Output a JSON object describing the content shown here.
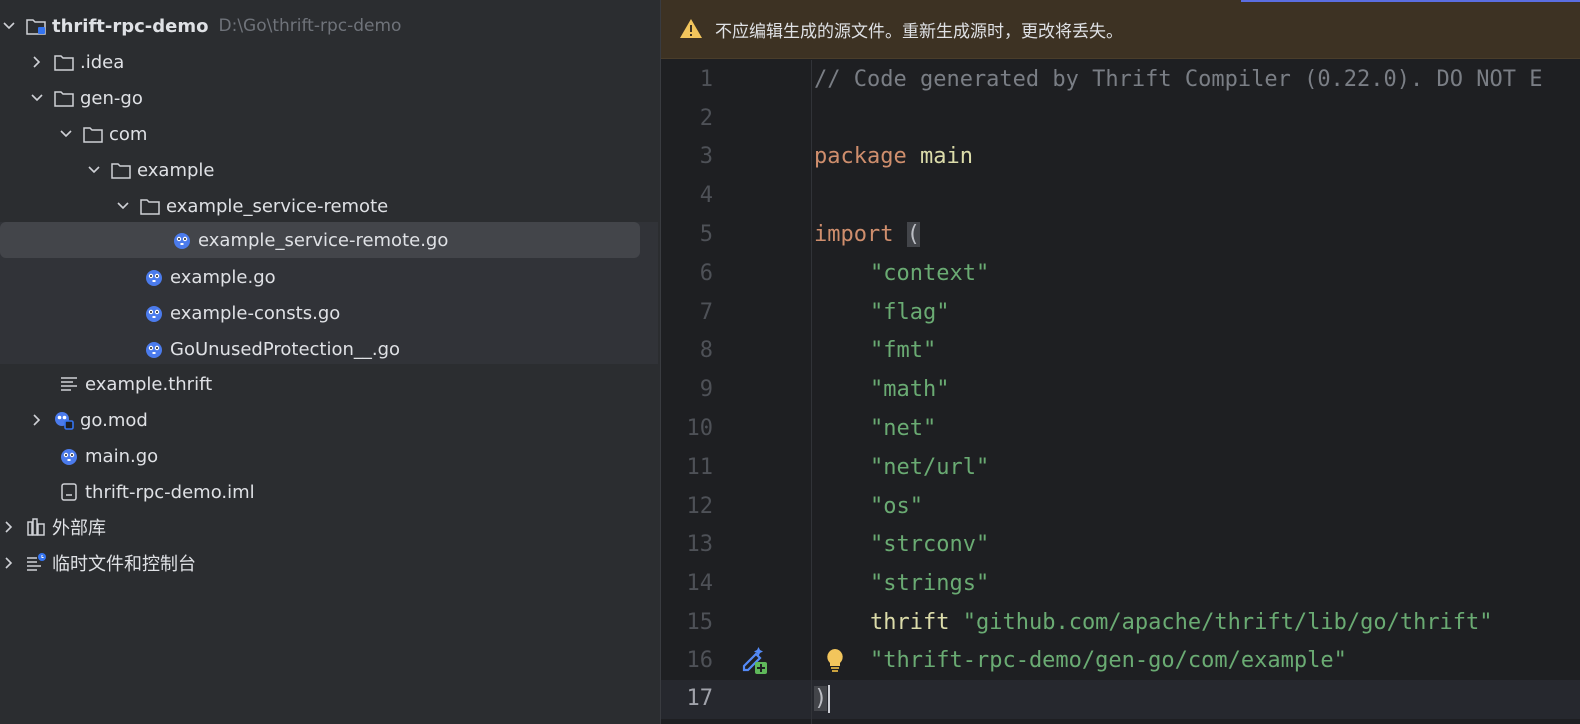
{
  "project_tree": {
    "root": {
      "label": "thrift-rpc-demo",
      "path": "D:\\Go\\thrift-rpc-demo"
    },
    "items": [
      {
        "label": ".idea"
      },
      {
        "label": "gen-go"
      },
      {
        "label": "com"
      },
      {
        "label": "example"
      },
      {
        "label": "example_service-remote"
      },
      {
        "label": "example_service-remote.go"
      },
      {
        "label": "example.go"
      },
      {
        "label": "example-consts.go"
      },
      {
        "label": "GoUnusedProtection__.go"
      },
      {
        "label": "example.thrift"
      },
      {
        "label": "go.mod"
      },
      {
        "label": "main.go"
      },
      {
        "label": "thrift-rpc-demo.iml"
      },
      {
        "label": "外部库"
      },
      {
        "label": "临时文件和控制台"
      }
    ]
  },
  "editor": {
    "banner": "不应编辑生成的源文件。重新生成源时，更改将丢失。",
    "line_numbers": [
      "1",
      "2",
      "3",
      "4",
      "5",
      "6",
      "7",
      "8",
      "9",
      "10",
      "11",
      "12",
      "13",
      "14",
      "15",
      "16",
      "17"
    ],
    "current_line": "17",
    "code": {
      "l1": "// Code generated by Thrift Compiler (0.22.0). DO NOT E",
      "l3_kw": "package",
      "l3_id": "main",
      "l5_kw": "import",
      "l5_paren": "(",
      "l6": "\"context\"",
      "l7": "\"flag\"",
      "l8": "\"fmt\"",
      "l9": "\"math\"",
      "l10": "\"net\"",
      "l11": "\"net/url\"",
      "l12": "\"os\"",
      "l13": "\"strconv\"",
      "l14": "\"strings\"",
      "l15_id": "thrift",
      "l15_str": "\"github.com/apache/thrift/lib/go/thrift\"",
      "l16": "\"thrift-rpc-demo/gen-go/com/example\"",
      "l17": ")"
    }
  },
  "colors": {
    "accent": "#5b6ee1",
    "warning": "#f2c55c",
    "string": "#6aab73",
    "keyword": "#cf8e6d"
  },
  "icons": [
    "chevron-down-icon",
    "chevron-right-icon",
    "folder-icon",
    "go-file-icon",
    "text-file-icon",
    "go-mod-icon",
    "iml-file-icon",
    "library-icon",
    "scratch-icon",
    "warning-icon",
    "bulb-icon",
    "add-gutter-icon"
  ]
}
